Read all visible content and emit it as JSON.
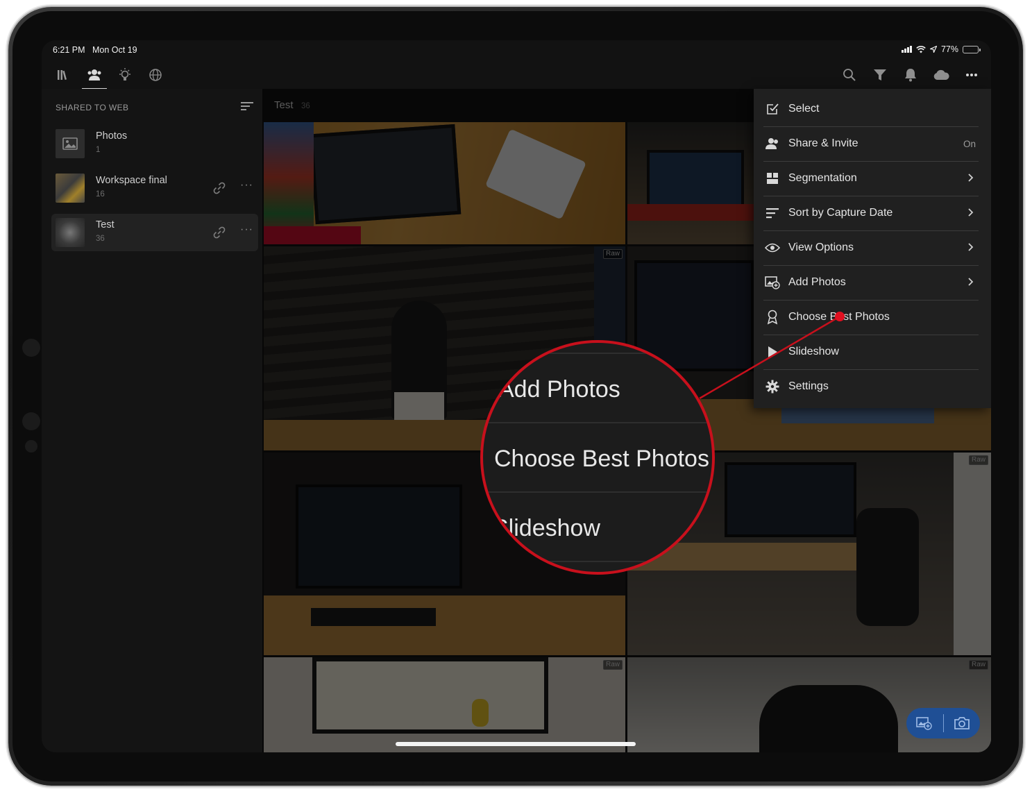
{
  "status_bar": {
    "time": "6:21 PM",
    "date": "Mon Oct 19",
    "battery": "77%",
    "battery_level": 0.77
  },
  "toolbar": {
    "left_icons": [
      "library-icon",
      "shared-people-icon",
      "learn-lightbulb-icon",
      "globe-icon"
    ],
    "right_icons": [
      "search-icon",
      "filter-icon",
      "notifications-icon",
      "cloud-icon",
      "more-icon"
    ]
  },
  "sidebar": {
    "header": "SHARED TO WEB",
    "albums": [
      {
        "name": "Photos",
        "count": "1"
      },
      {
        "name": "Workspace final",
        "count": "16"
      },
      {
        "name": "Test",
        "count": "36"
      }
    ]
  },
  "grid": {
    "title": "Test",
    "count": "36",
    "raw_badge": "Raw"
  },
  "menu": {
    "items": [
      {
        "label": "Select",
        "icon": "select-checkbox-icon"
      },
      {
        "label": "Share & Invite",
        "icon": "share-people-icon",
        "value": "On"
      },
      {
        "label": "Segmentation",
        "icon": "segmentation-grid-icon"
      },
      {
        "label": "Sort by Capture Date",
        "icon": "sort-icon"
      },
      {
        "label": "View Options",
        "icon": "view-eye-icon"
      },
      {
        "label": "Add Photos",
        "icon": "add-photos-icon"
      },
      {
        "label": "Choose Best Photos",
        "icon": "award-ribbon-icon"
      },
      {
        "label": "Slideshow",
        "icon": "play-icon"
      },
      {
        "label": "Settings",
        "icon": "gear-icon"
      }
    ]
  },
  "magnifier": {
    "lines": [
      "Add Photos",
      "Choose Best Photos",
      "Slideshow"
    ],
    "color": "#c8101c"
  },
  "fab": {
    "icons": [
      "add-photo-icon",
      "camera-icon"
    ],
    "color": "#1f4f95"
  }
}
